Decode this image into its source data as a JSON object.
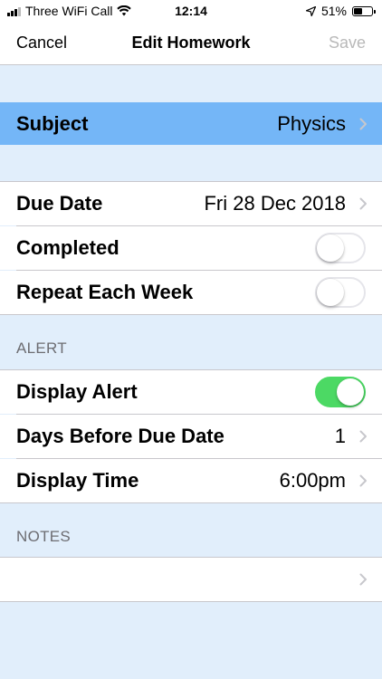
{
  "status_bar": {
    "carrier": "Three WiFi Call",
    "time": "12:14",
    "battery": "51%",
    "battery_level": 0.51
  },
  "nav": {
    "cancel_label": "Cancel",
    "title": "Edit Homework",
    "save_label": "Save"
  },
  "subject": {
    "label": "Subject",
    "value": "Physics",
    "highlight_color": "#74b6f7"
  },
  "schedule": {
    "due_date_label": "Due Date",
    "due_date_value": "Fri 28 Dec 2018",
    "completed_label": "Completed",
    "completed_on": false,
    "repeat_label": "Repeat Each Week",
    "repeat_on": false
  },
  "alert": {
    "header": "ALERT",
    "display_alert_label": "Display Alert",
    "display_alert_on": true,
    "days_before_label": "Days Before Due Date",
    "days_before_value": "1",
    "display_time_label": "Display Time",
    "display_time_value": "6:00pm"
  },
  "notes": {
    "header": "NOTES",
    "value": ""
  },
  "colors": {
    "background": "#e1eefb",
    "toggle_on": "#4cd964",
    "separator": "#c8c7cc"
  }
}
